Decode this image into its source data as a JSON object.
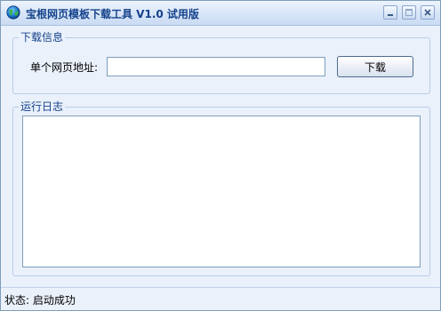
{
  "window": {
    "title": "宝根网页模板下载工具 V1.0 试用版",
    "app_icon": "globe-icon",
    "controls": {
      "minimize_icon": "minimize-icon",
      "maximize_icon": "maximize-icon",
      "close_icon": "close-icon"
    }
  },
  "download_group": {
    "legend": "下载信息",
    "url_label": "单个网页地址:",
    "url_value": "",
    "download_button": "下载"
  },
  "log_group": {
    "legend": "运行日志",
    "entries": []
  },
  "status_bar": {
    "text": "状态: 启动成功"
  },
  "colors": {
    "title_text": "#15428b",
    "legend_text": "#15428b",
    "window_background": "#eaf1fb",
    "border": "#7f9db9"
  }
}
